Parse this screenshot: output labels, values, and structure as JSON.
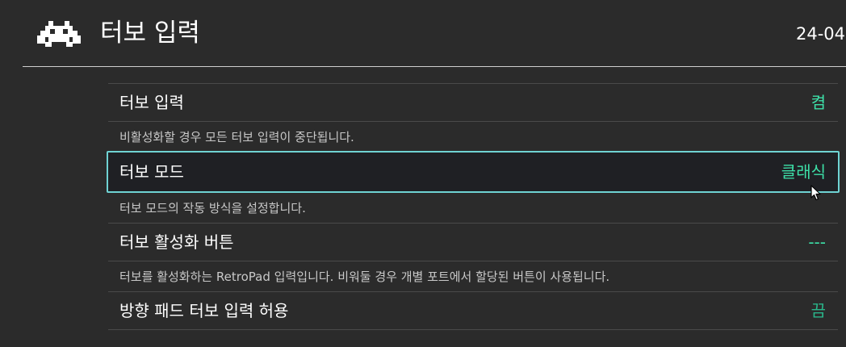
{
  "header": {
    "title": "터보 입력",
    "clock": "24-04",
    "logo_icon": "retroarch-invader-icon"
  },
  "settings": [
    {
      "label": "터보 입력",
      "value": "켬",
      "description": "비활성화할 경우 모든 터보 입력이 중단됩니다.",
      "selected": false
    },
    {
      "label": "터보 모드",
      "value": "클래식",
      "description": "터보 모드의 작동 방식을 설정합니다.",
      "selected": true
    },
    {
      "label": "터보 활성화 버튼",
      "value": "---",
      "description": "터보를 활성화하는 RetroPad 입력입니다. 비워둘 경우 개별 포트에서 할당된 버튼이 사용됩니다.",
      "selected": false
    },
    {
      "label": "방향 패드 터보 입력 허용",
      "value": "끔",
      "selected": false
    }
  ],
  "colors": {
    "background": "#2b2b2b",
    "accent_value": "#3de0a8",
    "selection_border": "#6fd3d3"
  }
}
